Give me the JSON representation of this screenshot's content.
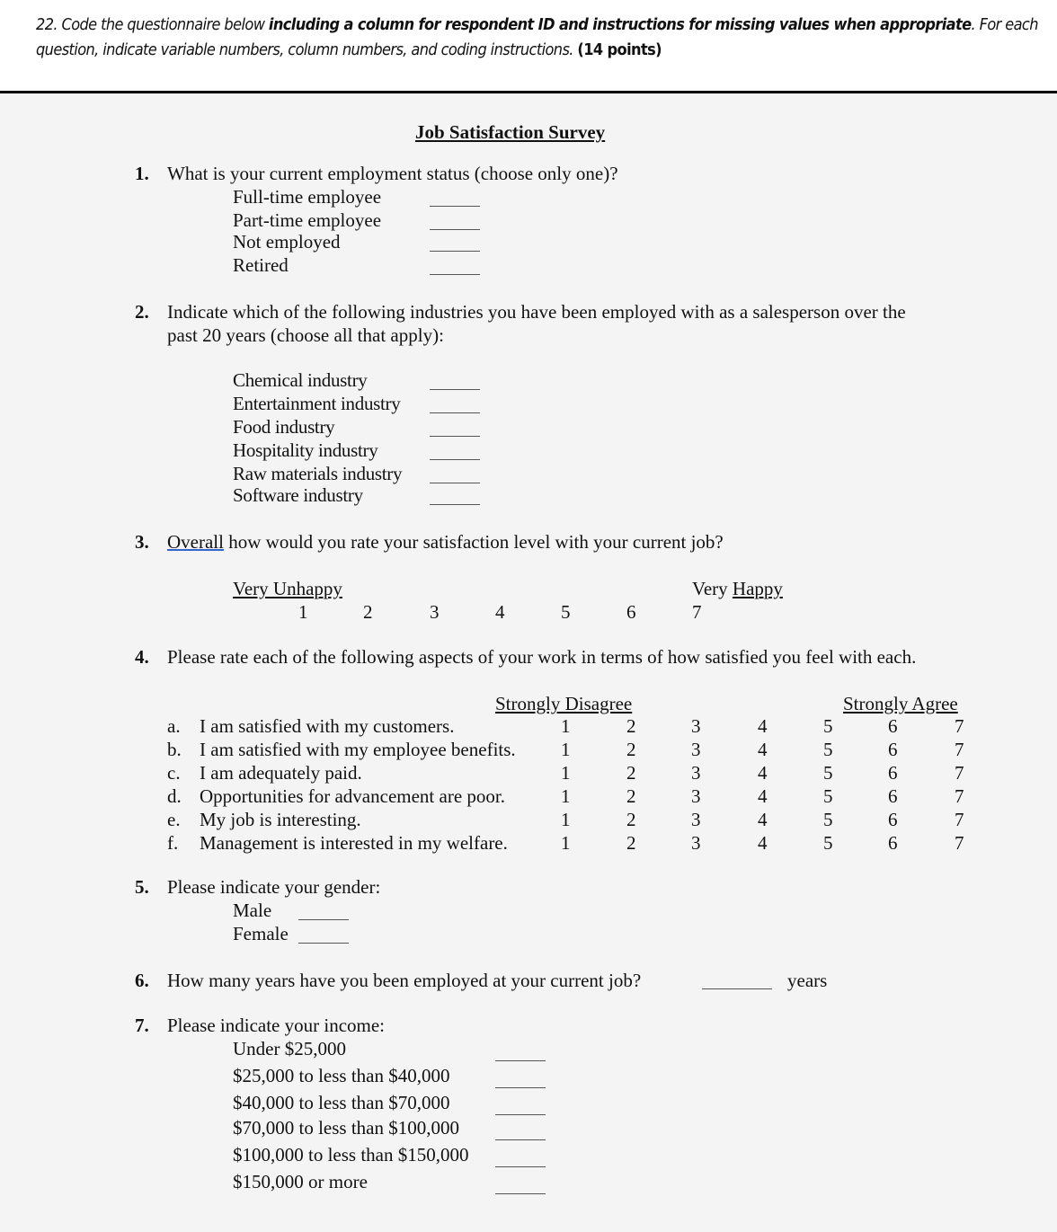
{
  "prompt": {
    "part1": "22. Code the questionnaire below ",
    "bold1": "including a column for respondent ID and instructions for missing values when appropriate",
    "part2": ". For each question, indicate variable numbers, column numbers, and coding instructions. ",
    "points": "(14 points)"
  },
  "survey": {
    "title": "Job Satisfaction Survey",
    "q1": {
      "number": "1.",
      "text": "What is your current employment status (choose only one)?",
      "options": [
        "Full-time employee",
        "Part-time employee",
        "Not employed",
        "Retired"
      ]
    },
    "q2": {
      "number": "2.",
      "text_line1": "Indicate which of the following industries you have been employed with as a salesperson over the",
      "text_line2": "past 20 years (choose all that apply):",
      "options": [
        "Chemical industry",
        "Entertainment industry",
        "Food industry",
        "Hospitality industry",
        "Raw materials industry",
        "Software industry"
      ]
    },
    "q3": {
      "number": "3.",
      "text_first": "Overall",
      "text_rest": " how would you rate your satisfaction level with your current job?",
      "low_label": "Very Unhappy",
      "high_label_a": "Very ",
      "high_label_b": "Happy",
      "scale": [
        "1",
        "2",
        "3",
        "4",
        "5",
        "6",
        "7"
      ]
    },
    "q4": {
      "number": "4.",
      "text": "Please rate each of the following aspects of your work in terms of how satisfied you feel with each.",
      "low_label": "Strongly Disagree",
      "high_label": "Strongly Agree",
      "scale": [
        "1",
        "2",
        "3",
        "4",
        "5",
        "6",
        "7"
      ],
      "items": [
        {
          "letter": "a.",
          "text": "I am satisfied with my customers."
        },
        {
          "letter": "b.",
          "text": "I am satisfied with my employee benefits."
        },
        {
          "letter": "c.",
          "text": "I am adequately paid."
        },
        {
          "letter": "d.",
          "text": "Opportunities for advancement are poor."
        },
        {
          "letter": "e.",
          "text": "My job is interesting."
        },
        {
          "letter": "f.",
          "text": "Management is interested in my welfare."
        }
      ]
    },
    "q5": {
      "number": "5.",
      "text": "Please indicate your gender:",
      "options": [
        "Male",
        "Female"
      ]
    },
    "q6": {
      "number": "6.",
      "text": "How many years have you been employed at your current job?",
      "unit": "years"
    },
    "q7": {
      "number": "7.",
      "text": "Please indicate your income:",
      "options": [
        "Under $25,000",
        "$25,000 to less than $40,000",
        "$40,000 to less than $70,000",
        "$70,000 to less than $100,000",
        "$100,000 to less than $150,000",
        "$150,000 or more"
      ]
    }
  }
}
